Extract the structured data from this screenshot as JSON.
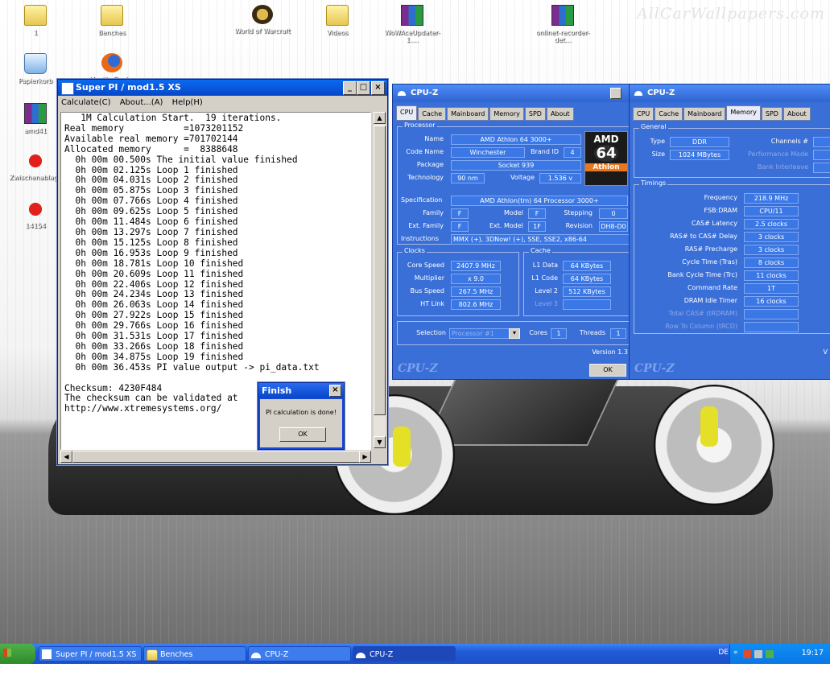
{
  "wallpaper": {
    "watermark": "AllCarWallpapers.com"
  },
  "desktop_icons": [
    {
      "label": "1",
      "icon": "folder-icon"
    },
    {
      "label": "Benches",
      "icon": "folder-icon"
    },
    {
      "label": "World of Warcraft",
      "icon": "wow-icon"
    },
    {
      "label": "Videos",
      "icon": "folder-icon"
    },
    {
      "label": "WoWAceUpdater-1....",
      "icon": "archive-icon"
    },
    {
      "label": "onlinet-recorder-det...",
      "icon": "archive-icon"
    },
    {
      "label": "Papierkorb",
      "icon": "recycle-bin-icon"
    },
    {
      "label": "Mozilla Firefox",
      "icon": "firefox-icon"
    },
    {
      "label": "amd41",
      "icon": "archive-icon"
    },
    {
      "label": "Zwischenablage",
      "icon": "splat-icon"
    },
    {
      "label": "14154",
      "icon": "splat-icon"
    }
  ],
  "superpi": {
    "title": "Super PI / mod1.5 XS",
    "menu": [
      "Calculate(C)",
      "About...(A)",
      "Help(H)"
    ],
    "lines": [
      "   1M Calculation Start.  19 iterations.",
      "Real memory           =1073201152",
      "Available real memory =701702144",
      "Allocated memory      =  8388648",
      "  0h 00m 00.500s The initial value finished",
      "  0h 00m 02.125s Loop 1 finished",
      "  0h 00m 04.031s Loop 2 finished",
      "  0h 00m 05.875s Loop 3 finished",
      "  0h 00m 07.766s Loop 4 finished",
      "  0h 00m 09.625s Loop 5 finished",
      "  0h 00m 11.484s Loop 6 finished",
      "  0h 00m 13.297s Loop 7 finished",
      "  0h 00m 15.125s Loop 8 finished",
      "  0h 00m 16.953s Loop 9 finished",
      "  0h 00m 18.781s Loop 10 finished",
      "  0h 00m 20.609s Loop 11 finished",
      "  0h 00m 22.406s Loop 12 finished",
      "  0h 00m 24.234s Loop 13 finished",
      "  0h 00m 26.063s Loop 14 finished",
      "  0h 00m 27.922s Loop 15 finished",
      "  0h 00m 29.766s Loop 16 finished",
      "  0h 00m 31.531s Loop 17 finished",
      "  0h 00m 33.266s Loop 18 finished",
      "  0h 00m 34.875s Loop 19 finished",
      "  0h 00m 36.453s PI value output -> pi_data.txt",
      "",
      "Checksum: 4230F484",
      "The checksum can be validated at",
      "http://www.xtremesystems.org/"
    ]
  },
  "finish": {
    "title": "Finish",
    "message": "PI calculation is done!",
    "ok": "OK"
  },
  "cpuz1": {
    "title": "CPU-Z",
    "tabs": [
      "CPU",
      "Cache",
      "Mainboard",
      "Memory",
      "SPD",
      "About"
    ],
    "processor_title": "Processor",
    "name_label": "Name",
    "name": "AMD Athlon 64 3000+",
    "codename_label": "Code Name",
    "codename": "Winchester",
    "brandid_label": "Brand ID",
    "brandid": "4",
    "package_label": "Package",
    "package": "Socket 939",
    "technology_label": "Technology",
    "technology": "90 nm",
    "voltage_label": "Voltage",
    "voltage": "1.536 v",
    "spec_label": "Specification",
    "spec": "AMD Athlon(tm) 64 Processor 3000+",
    "family_label": "Family",
    "family": "F",
    "model_label": "Model",
    "model": "F",
    "stepping_label": "Stepping",
    "stepping": "0",
    "extfamily_label": "Ext. Family",
    "extfamily": "F",
    "extmodel_label": "Ext. Model",
    "extmodel": "1F",
    "revision_label": "Revision",
    "revision": "DH8-D0",
    "instructions_label": "Instructions",
    "instructions": "MMX (+), 3DNow! (+), SSE, SSE2, x86-64",
    "clocks_title": "Clocks",
    "corespeed_label": "Core Speed",
    "corespeed": "2407.9 MHz",
    "multiplier_label": "Multiplier",
    "multiplier": "x 9.0",
    "busspeed_label": "Bus Speed",
    "busspeed": "267.5 MHz",
    "htlink_label": "HT Link",
    "htlink": "802.6 MHz",
    "cache_title": "Cache",
    "l1data_label": "L1 Data",
    "l1data": "64 KBytes",
    "l1code_label": "L1 Code",
    "l1code": "64 KBytes",
    "level2_label": "Level 2",
    "level2": "512 KBytes",
    "level3_label": "Level 3",
    "selection_label": "Selection",
    "selection": "Processor #1",
    "cores_label": "Cores",
    "cores": "1",
    "threads_label": "Threads",
    "threads": "1",
    "version": "Version 1.3",
    "logo": "CPU-Z",
    "ok": "OK",
    "amd_logo": {
      "top": "AMD",
      "mid": "64",
      "bottom": "Athlon"
    }
  },
  "cpuz2": {
    "title": "CPU-Z",
    "tabs": [
      "CPU",
      "Cache",
      "Mainboard",
      "Memory",
      "SPD",
      "About"
    ],
    "general_title": "General",
    "type_label": "Type",
    "type": "DDR",
    "channels_label": "Channels #",
    "size_label": "Size",
    "size": "1024 MBytes",
    "perfmode_label": "Performance Mode",
    "bankinterleave_label": "Bank Interleave",
    "timings_title": "Timings",
    "frequency_label": "Frequency",
    "frequency": "218.9 MHz",
    "fsbdram_label": "FSB:DRAM",
    "fsbdram": "CPU/11",
    "cas_label": "CAS# Latency",
    "cas": "2.5 clocks",
    "rcd_label": "RAS# to CAS# Delay",
    "rcd": "3 clocks",
    "rp_label": "RAS# Precharge",
    "rp": "3 clocks",
    "tras_label": "Cycle Time (Tras)",
    "tras": "8 clocks",
    "trc_label": "Bank Cycle Time (Trc)",
    "trc": "11 clocks",
    "cr_label": "Command Rate",
    "cr": "1T",
    "idle_label": "DRAM Idle Timer",
    "idle": "16 clocks",
    "totalcas_label": "Total CAS# (tRDRAM)",
    "rowcol_label": "Row To Column (tRCD)",
    "version": "V",
    "logo": "CPU-Z"
  },
  "taskbar": {
    "start": "Start",
    "tasks": [
      "Super PI / mod1.5 XS",
      "Benches",
      "CPU-Z",
      "CPU-Z"
    ],
    "lang": "DE",
    "time": "19:17"
  }
}
